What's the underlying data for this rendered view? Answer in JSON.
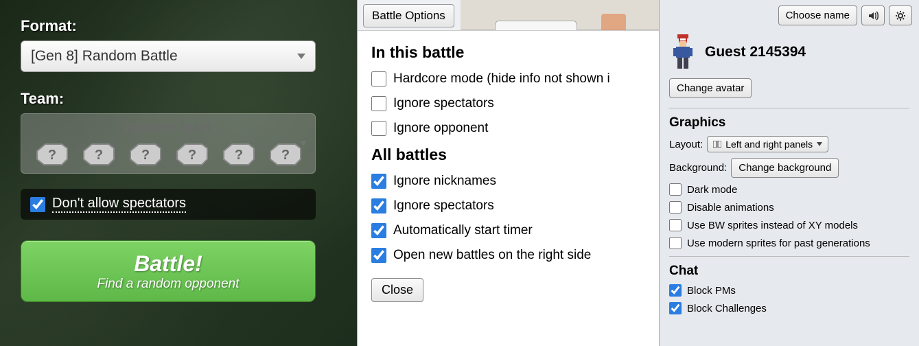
{
  "left": {
    "format_label": "Format:",
    "format_value": "[Gen 8] Random Battle",
    "team_label": "Team:",
    "team_title": "Random team",
    "no_spectators": {
      "label": "Don't allow spectators",
      "checked": true
    },
    "battle_button": {
      "main": "Battle!",
      "sub": "Find a random opponent"
    }
  },
  "mid": {
    "options_button": "Battle Options",
    "heading1": "In this battle",
    "opts1": [
      {
        "label": "Hardcore mode (hide info not shown i",
        "checked": false
      },
      {
        "label": "Ignore spectators",
        "checked": false
      },
      {
        "label": "Ignore opponent",
        "checked": false
      }
    ],
    "heading2": "All battles",
    "opts2": [
      {
        "label": "Ignore nicknames",
        "checked": true
      },
      {
        "label": "Ignore spectators",
        "checked": true
      },
      {
        "label": "Automatically start timer",
        "checked": true
      },
      {
        "label": "Open new battles on the right side",
        "checked": true
      }
    ],
    "close": "Close"
  },
  "right": {
    "choose_name": "Choose name",
    "username": "Guest 2145394",
    "change_avatar": "Change avatar",
    "graphics_heading": "Graphics",
    "layout_label": "Layout:",
    "layout_value": "Left and right panels",
    "background_label": "Background:",
    "change_background": "Change background",
    "gfx_opts": [
      {
        "label": "Dark mode",
        "checked": false
      },
      {
        "label": "Disable animations",
        "checked": false
      },
      {
        "label": "Use BW sprites instead of XY models",
        "checked": false
      },
      {
        "label": "Use modern sprites for past generations",
        "checked": false
      }
    ],
    "chat_heading": "Chat",
    "chat_opts": [
      {
        "label": "Block PMs",
        "checked": true
      },
      {
        "label": "Block Challenges",
        "checked": true
      }
    ]
  }
}
